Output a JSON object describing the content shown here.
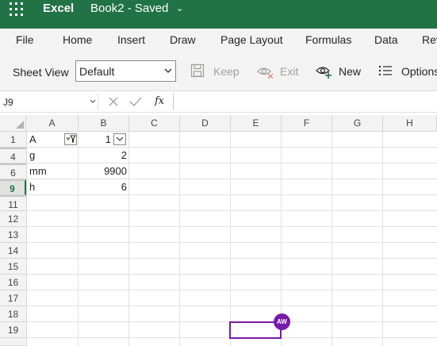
{
  "titlebar": {
    "app_name": "Excel",
    "doc_title": "Book2 - Saved",
    "chevron": "⌄",
    "bg_color": "#217346"
  },
  "menu": {
    "items": [
      "File",
      "Home",
      "Insert",
      "Draw",
      "Page Layout",
      "Formulas",
      "Data",
      "Rev"
    ]
  },
  "toolbar": {
    "sheet_view_label": "Sheet View",
    "sheet_view_value": "Default",
    "keep_label": "Keep",
    "exit_label": "Exit",
    "new_label": "New",
    "options_label": "Options"
  },
  "formula_bar": {
    "name_box": "J9",
    "fx": "fx",
    "value": ""
  },
  "columns": [
    "A",
    "B",
    "C",
    "D",
    "E",
    "F",
    "G",
    "H"
  ],
  "rows": [
    "1",
    "4",
    "6",
    "9",
    "11",
    "12",
    "13",
    "14",
    "15",
    "16",
    "17",
    "18",
    "19"
  ],
  "active_row": "9",
  "cells": {
    "r1": {
      "a": "A",
      "b": "1"
    },
    "r4": {
      "a": "g",
      "b": "2"
    },
    "r6": {
      "a": "mm",
      "b": "9900"
    },
    "r9": {
      "a": "h",
      "b": "6"
    }
  },
  "presence": {
    "initials": "AW",
    "color": "#7719aa"
  }
}
